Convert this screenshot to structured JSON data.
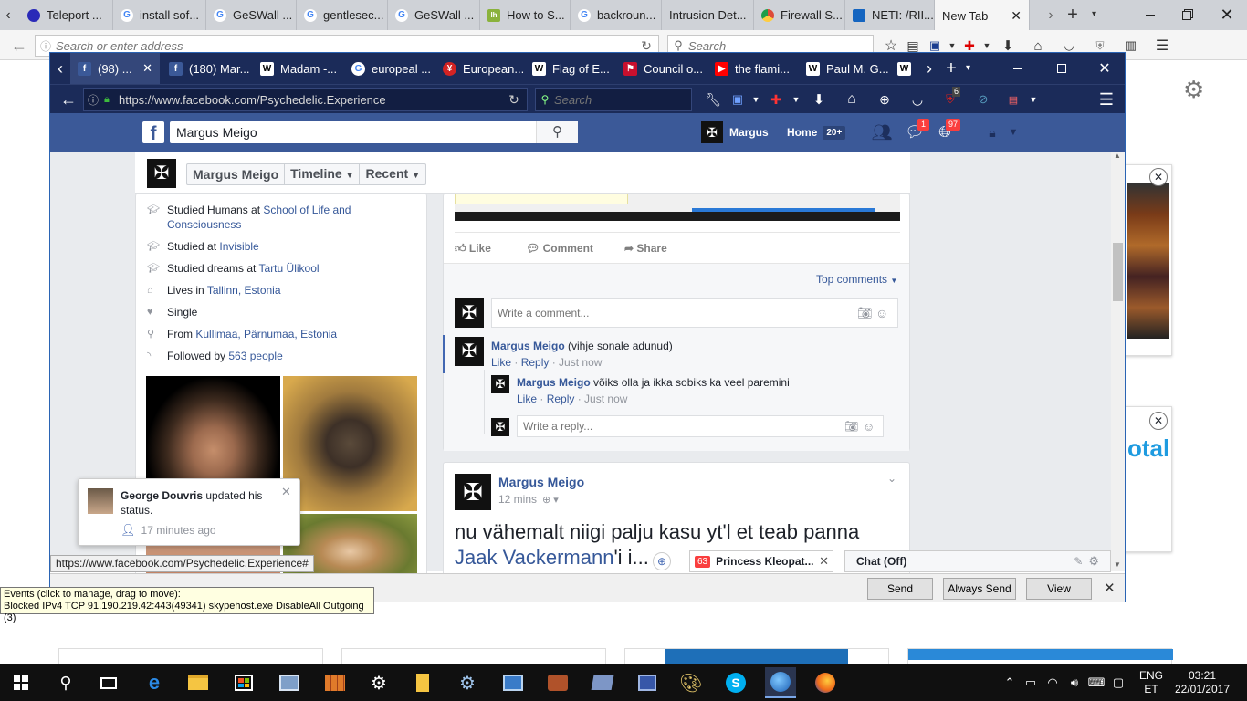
{
  "outer_tabs": [
    {
      "label": "Teleport ...",
      "icon": "teleport-icon",
      "color": "#2a2ab8"
    },
    {
      "label": "install sof...",
      "icon": "google-icon",
      "color": "#4285f4"
    },
    {
      "label": "GeSWall ...",
      "icon": "google-icon",
      "color": "#4285f4"
    },
    {
      "label": "gentlesec...",
      "icon": "google-icon",
      "color": "#4285f4"
    },
    {
      "label": "GeSWall ...",
      "icon": "google-icon",
      "color": "#4285f4"
    },
    {
      "label": "How to S...",
      "icon": "lifehacker-icon",
      "color": "#8ab23c"
    },
    {
      "label": "backroun...",
      "icon": "google-icon",
      "color": "#4285f4"
    },
    {
      "label": "Intrusion Det...",
      "icon": "blank-page-icon",
      "color": "#bbbbbb"
    },
    {
      "label": "Firewall S...",
      "icon": "chrome-icon",
      "color": "#dd4b39"
    },
    {
      "label": "NETI: /RII...",
      "icon": "neti-icon",
      "color": "#1565c0"
    },
    {
      "label": "New Tab",
      "icon": "",
      "color": ""
    }
  ],
  "outer_address": {
    "placeholder": "Search or enter address",
    "search_placeholder": "Search"
  },
  "inner_tabs": [
    {
      "label": "(98) ...",
      "icon": "facebook-icon",
      "color": "#3b5998",
      "glyph": "f"
    },
    {
      "label": "(180) Mar...",
      "icon": "facebook-icon",
      "color": "#3b5998",
      "glyph": "f"
    },
    {
      "label": "Madam -...",
      "icon": "wikipedia-icon",
      "color": "#ffffff",
      "glyph": "W"
    },
    {
      "label": "europeal ...",
      "icon": "google-icon",
      "color": "#ffffff",
      "glyph": "G"
    },
    {
      "label": "European...",
      "icon": "yelp-icon",
      "color": "#d32323",
      "glyph": "¥"
    },
    {
      "label": "Flag of E...",
      "icon": "wikipedia-icon",
      "color": "#ffffff",
      "glyph": "W"
    },
    {
      "label": "Council o...",
      "icon": "coat-of-arms-icon",
      "color": "#c8102e",
      "glyph": "⚑"
    },
    {
      "label": "the flami...",
      "icon": "youtube-icon",
      "color": "#ff0000",
      "glyph": "▶"
    },
    {
      "label": "Paul M. G...",
      "icon": "wikipedia-icon",
      "color": "#ffffff",
      "glyph": "W"
    },
    {
      "label": "",
      "icon": "wikipedia-icon",
      "color": "#ffffff",
      "glyph": "W"
    }
  ],
  "inner_address": {
    "url": "https://www.facebook.com/Psychedelic.Experience",
    "search_placeholder": "Search",
    "ublock_count": "6"
  },
  "fb_header": {
    "search_value": "Margus Meigo",
    "user_name": "Margus",
    "home_label": "Home",
    "home_badge": "20+",
    "messages_badge": "1",
    "notifications_badge": "97"
  },
  "profile_nav": {
    "name": "Margus Meigo",
    "timeline_label": "Timeline",
    "recent_label": "Recent"
  },
  "intro": [
    {
      "icon": "graduation-cap-icon",
      "prefix": "Studied Humans at ",
      "link": "School of Life and Consciousness"
    },
    {
      "icon": "graduation-cap-icon",
      "prefix": "Studied at ",
      "link": "Invisible"
    },
    {
      "icon": "graduation-cap-icon",
      "prefix": "Studied dreams at ",
      "link": "Tartu Ülikool"
    },
    {
      "icon": "home-icon",
      "prefix": "Lives in ",
      "link": "Tallinn, Estonia"
    },
    {
      "icon": "heart-icon",
      "prefix": "Single",
      "link": ""
    },
    {
      "icon": "map-pin-icon",
      "prefix": "From ",
      "link": "Kullimaa, Pärnumaa, Estonia"
    },
    {
      "icon": "rss-icon",
      "prefix": "Followed by ",
      "link": "563 people"
    }
  ],
  "post1": {
    "like": "Like",
    "comment": "Comment",
    "share": "Share",
    "top_comments": "Top comments",
    "write_comment_placeholder": "Write a comment...",
    "write_reply_placeholder": "Write a reply..."
  },
  "comments": [
    {
      "author": "Margus Meigo",
      "text": "(vihje sonale adunud)",
      "like": "Like",
      "reply": "Reply",
      "time": "Just now"
    },
    {
      "author": "Margus Meigo",
      "text": "võiks olla ja ikka sobiks ka veel paremini",
      "like": "Like",
      "reply": "Reply",
      "time": "Just now"
    }
  ],
  "post2": {
    "author": "Margus Meigo",
    "time": "12 mins",
    "text_before": "nu vähemalt niigi palju kasu yt'l et teab panna ",
    "mention": "Jaak Vackermann",
    "text_after": "'i i..."
  },
  "notification": {
    "name": "George Douvris",
    "text": " updated his status.",
    "time": "17 minutes ago"
  },
  "status_url": "https://www.facebook.com/Psychedelic.Experience#",
  "chat": {
    "tab_badge": "63",
    "tab_label": "Princess Kleopat...",
    "chat_label": "Chat (Off)"
  },
  "events": {
    "title": "Events (click to manage, drag to move):",
    "message": "Blocked IPv4 TCP 91.190.219.42:443(49341) skypehost.exe DisableAll Outgoing (3)"
  },
  "event_buttons": {
    "send": "Send",
    "always_send": "Always Send",
    "view": "View"
  },
  "taskbar": {
    "lang_top": "ENG",
    "lang_bottom": "ET",
    "time": "03:21",
    "date": "22/01/2017"
  }
}
